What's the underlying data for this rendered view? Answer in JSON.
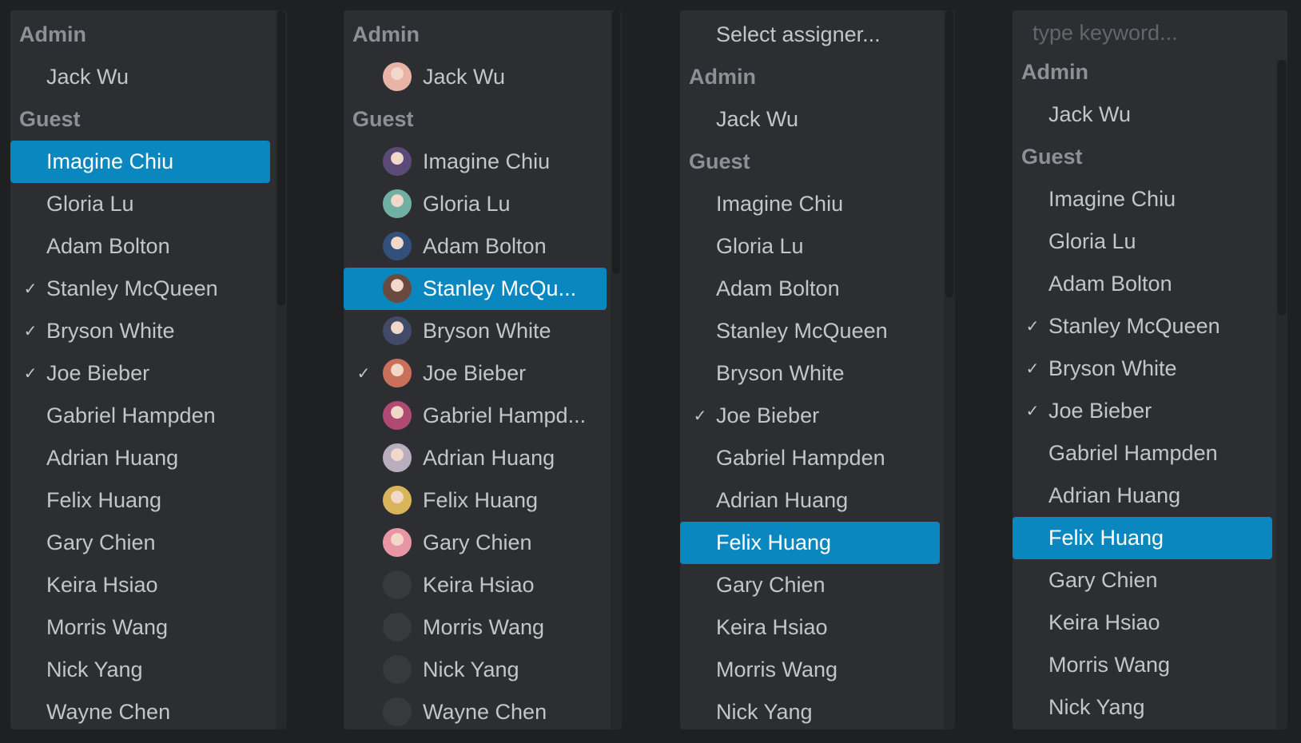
{
  "dropdowns": [
    {
      "id": "plain-list",
      "items": [
        {
          "type": "group",
          "label": "Admin"
        },
        {
          "type": "option",
          "label": "Jack Wu",
          "checked": false,
          "selected": false
        },
        {
          "type": "group",
          "label": "Guest"
        },
        {
          "type": "option",
          "label": "Imagine Chiu",
          "checked": false,
          "selected": true
        },
        {
          "type": "option",
          "label": "Gloria Lu",
          "checked": false,
          "selected": false
        },
        {
          "type": "option",
          "label": "Adam Bolton",
          "checked": false,
          "selected": false
        },
        {
          "type": "option",
          "label": "Stanley McQueen",
          "checked": true,
          "selected": false
        },
        {
          "type": "option",
          "label": "Bryson White",
          "checked": true,
          "selected": false
        },
        {
          "type": "option",
          "label": "Joe Bieber",
          "checked": true,
          "selected": false
        },
        {
          "type": "option",
          "label": "Gabriel Hampden",
          "checked": false,
          "selected": false
        },
        {
          "type": "option",
          "label": "Adrian Huang",
          "checked": false,
          "selected": false
        },
        {
          "type": "option",
          "label": "Felix Huang",
          "checked": false,
          "selected": false
        },
        {
          "type": "option",
          "label": "Gary Chien",
          "checked": false,
          "selected": false
        },
        {
          "type": "option",
          "label": "Keira Hsiao",
          "checked": false,
          "selected": false
        },
        {
          "type": "option",
          "label": "Morris Wang",
          "checked": false,
          "selected": false
        },
        {
          "type": "option",
          "label": "Nick Yang",
          "checked": false,
          "selected": false
        },
        {
          "type": "option",
          "label": "Wayne Chen",
          "checked": false,
          "selected": false
        }
      ]
    },
    {
      "id": "avatar-list",
      "items": [
        {
          "type": "group",
          "label": "Admin"
        },
        {
          "type": "option",
          "label": "Jack Wu",
          "checked": false,
          "selected": false,
          "avatar": "#e8b4a8"
        },
        {
          "type": "group",
          "label": "Guest"
        },
        {
          "type": "option",
          "label": "Imagine Chiu",
          "checked": false,
          "selected": false,
          "avatar": "#5b4a78"
        },
        {
          "type": "option",
          "label": "Gloria Lu",
          "checked": false,
          "selected": false,
          "avatar": "#6fb0a2"
        },
        {
          "type": "option",
          "label": "Adam Bolton",
          "checked": false,
          "selected": false,
          "avatar": "#33507a"
        },
        {
          "type": "option",
          "label": "Stanley McQu...",
          "checked": false,
          "selected": true,
          "avatar": "#6a4a3e"
        },
        {
          "type": "option",
          "label": "Bryson White",
          "checked": false,
          "selected": false,
          "avatar": "#414a66"
        },
        {
          "type": "option",
          "label": "Joe Bieber",
          "checked": true,
          "selected": false,
          "avatar": "#c9705a"
        },
        {
          "type": "option",
          "label": "Gabriel Hampd...",
          "checked": false,
          "selected": false,
          "avatar": "#b04a72"
        },
        {
          "type": "option",
          "label": "Adrian Huang",
          "checked": false,
          "selected": false,
          "avatar": "#b9aec0"
        },
        {
          "type": "option",
          "label": "Felix Huang",
          "checked": false,
          "selected": false,
          "avatar": "#d9b45a"
        },
        {
          "type": "option",
          "label": "Gary Chien",
          "checked": false,
          "selected": false,
          "avatar": "#e896a6"
        },
        {
          "type": "option",
          "label": "Keira Hsiao",
          "checked": false,
          "selected": false,
          "avatar": ""
        },
        {
          "type": "option",
          "label": "Morris Wang",
          "checked": false,
          "selected": false,
          "avatar": ""
        },
        {
          "type": "option",
          "label": "Nick Yang",
          "checked": false,
          "selected": false,
          "avatar": ""
        },
        {
          "type": "option",
          "label": "Wayne Chen",
          "checked": false,
          "selected": false,
          "avatar": ""
        }
      ]
    },
    {
      "id": "with-placeholder",
      "items": [
        {
          "type": "option",
          "label": "Select assigner...",
          "checked": false,
          "selected": false
        },
        {
          "type": "group",
          "label": "Admin"
        },
        {
          "type": "option",
          "label": "Jack Wu",
          "checked": false,
          "selected": false
        },
        {
          "type": "group",
          "label": "Guest"
        },
        {
          "type": "option",
          "label": "Imagine Chiu",
          "checked": false,
          "selected": false
        },
        {
          "type": "option",
          "label": "Gloria Lu",
          "checked": false,
          "selected": false
        },
        {
          "type": "option",
          "label": "Adam Bolton",
          "checked": false,
          "selected": false
        },
        {
          "type": "option",
          "label": "Stanley McQueen",
          "checked": false,
          "selected": false
        },
        {
          "type": "option",
          "label": "Bryson White",
          "checked": false,
          "selected": false
        },
        {
          "type": "option",
          "label": "Joe Bieber",
          "checked": true,
          "selected": false
        },
        {
          "type": "option",
          "label": "Gabriel Hampden",
          "checked": false,
          "selected": false
        },
        {
          "type": "option",
          "label": "Adrian Huang",
          "checked": false,
          "selected": false
        },
        {
          "type": "option",
          "label": "Felix Huang",
          "checked": false,
          "selected": true
        },
        {
          "type": "option",
          "label": "Gary Chien",
          "checked": false,
          "selected": false
        },
        {
          "type": "option",
          "label": "Keira Hsiao",
          "checked": false,
          "selected": false
        },
        {
          "type": "option",
          "label": "Morris Wang",
          "checked": false,
          "selected": false
        },
        {
          "type": "option",
          "label": "Nick Yang",
          "checked": false,
          "selected": false
        }
      ]
    },
    {
      "id": "searchable-list",
      "search_placeholder": "type keyword...",
      "items": [
        {
          "type": "group",
          "label": "Admin"
        },
        {
          "type": "option",
          "label": "Jack Wu",
          "checked": false,
          "selected": false
        },
        {
          "type": "group",
          "label": "Guest"
        },
        {
          "type": "option",
          "label": "Imagine Chiu",
          "checked": false,
          "selected": false
        },
        {
          "type": "option",
          "label": "Gloria Lu",
          "checked": false,
          "selected": false
        },
        {
          "type": "option",
          "label": "Adam Bolton",
          "checked": false,
          "selected": false
        },
        {
          "type": "option",
          "label": "Stanley McQueen",
          "checked": true,
          "selected": false
        },
        {
          "type": "option",
          "label": "Bryson White",
          "checked": true,
          "selected": false
        },
        {
          "type": "option",
          "label": "Joe Bieber",
          "checked": true,
          "selected": false
        },
        {
          "type": "option",
          "label": "Gabriel Hampden",
          "checked": false,
          "selected": false
        },
        {
          "type": "option",
          "label": "Adrian Huang",
          "checked": false,
          "selected": false
        },
        {
          "type": "option",
          "label": "Felix Huang",
          "checked": false,
          "selected": true
        },
        {
          "type": "option",
          "label": "Gary Chien",
          "checked": false,
          "selected": false
        },
        {
          "type": "option",
          "label": "Keira Hsiao",
          "checked": false,
          "selected": false
        },
        {
          "type": "option",
          "label": "Morris Wang",
          "checked": false,
          "selected": false
        },
        {
          "type": "option",
          "label": "Nick Yang",
          "checked": false,
          "selected": false
        }
      ]
    }
  ],
  "check_glyph": "✓",
  "colors": {
    "selected_bg": "#0a87bf",
    "panel_bg": "#2d2e31",
    "page_bg": "#1f2022"
  }
}
